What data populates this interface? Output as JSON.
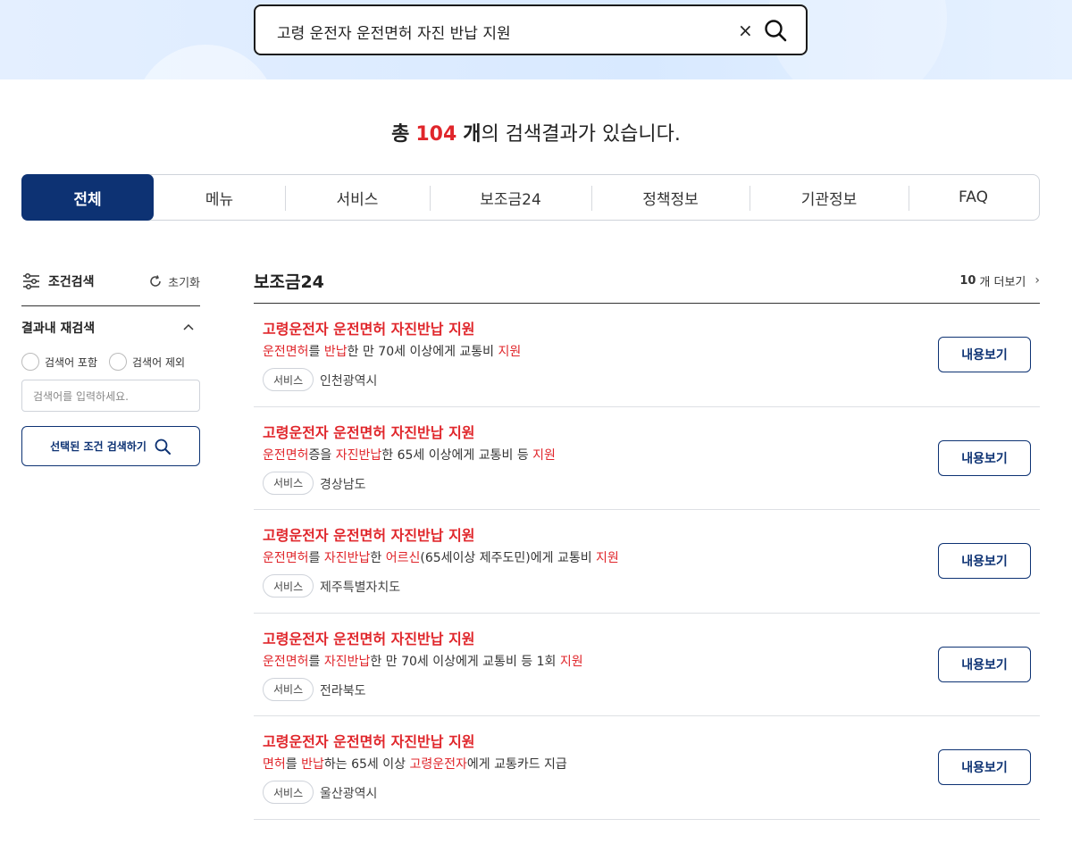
{
  "search": {
    "query": "고령 운전자 운전면허 자진 반납 지원",
    "clear_label": "×"
  },
  "summary": {
    "prefix": "총",
    "count": "104",
    "unit": "개",
    "suffix": "의 검색결과가 있습니다."
  },
  "tabs": [
    {
      "label": "전체",
      "active": true
    },
    {
      "label": "메뉴"
    },
    {
      "label": "서비스"
    },
    {
      "label": "보조금24"
    },
    {
      "label": "정책정보"
    },
    {
      "label": "기관정보"
    },
    {
      "label": "FAQ"
    }
  ],
  "sidebar": {
    "title": "조건검색",
    "reset_label": "초기화",
    "refine_title": "결과내 재검색",
    "radio_include": "검색어 포함",
    "radio_exclude": "검색어 제외",
    "input_placeholder": "검색어를 입력하세요.",
    "apply_label": "선택된 조건 검색하기"
  },
  "section": {
    "title": "보조금24",
    "more_count": "10",
    "more_label": "개 더보기"
  },
  "results": [
    {
      "title": "고령운전자 운전면허 자진반납 지원",
      "desc": [
        {
          "t": "운전면허",
          "hl": true
        },
        {
          "t": "를 "
        },
        {
          "t": "반납",
          "hl": true
        },
        {
          "t": "한 만 70세 이상에게 교통비 "
        },
        {
          "t": "지원",
          "hl": true
        }
      ],
      "tag": "서비스",
      "region": "인천광역시",
      "button": "내용보기"
    },
    {
      "title": "고령운전자 운전면허 자진반납 지원",
      "desc": [
        {
          "t": "운전면허",
          "hl": true
        },
        {
          "t": "증을 "
        },
        {
          "t": "자진반납",
          "hl": true
        },
        {
          "t": "한 65세 이상에게 교통비 등 "
        },
        {
          "t": "지원",
          "hl": true
        }
      ],
      "tag": "서비스",
      "region": "경상남도",
      "button": "내용보기"
    },
    {
      "title": "고령운전자 운전면허 자진반납 지원",
      "desc": [
        {
          "t": "운전면허",
          "hl": true
        },
        {
          "t": "를 "
        },
        {
          "t": "자진반납",
          "hl": true
        },
        {
          "t": "한 "
        },
        {
          "t": "어르신",
          "hl": true
        },
        {
          "t": "(65세이상 제주도민)에게 교통비 "
        },
        {
          "t": "지원",
          "hl": true
        }
      ],
      "tag": "서비스",
      "region": "제주특별자치도",
      "button": "내용보기"
    },
    {
      "title": "고령운전자 운전면허 자진반납 지원",
      "desc": [
        {
          "t": "운전면허",
          "hl": true
        },
        {
          "t": "를 "
        },
        {
          "t": "자진반납",
          "hl": true
        },
        {
          "t": "한 만 70세 이상에게 교통비 등 1회 "
        },
        {
          "t": "지원",
          "hl": true
        }
      ],
      "tag": "서비스",
      "region": "전라북도",
      "button": "내용보기"
    },
    {
      "title": "고령운전자 운전면허 자진반납 지원",
      "desc": [
        {
          "t": "면허",
          "hl": true
        },
        {
          "t": "를 "
        },
        {
          "t": "반납",
          "hl": true
        },
        {
          "t": "하는 65세 이상 "
        },
        {
          "t": "고령운전자",
          "hl": true
        },
        {
          "t": "에게 교통카드 지급"
        }
      ],
      "tag": "서비스",
      "region": "울산광역시",
      "button": "내용보기"
    }
  ],
  "colors": {
    "accent_navy": "#0d3273",
    "highlight_red": "#e0262b"
  }
}
